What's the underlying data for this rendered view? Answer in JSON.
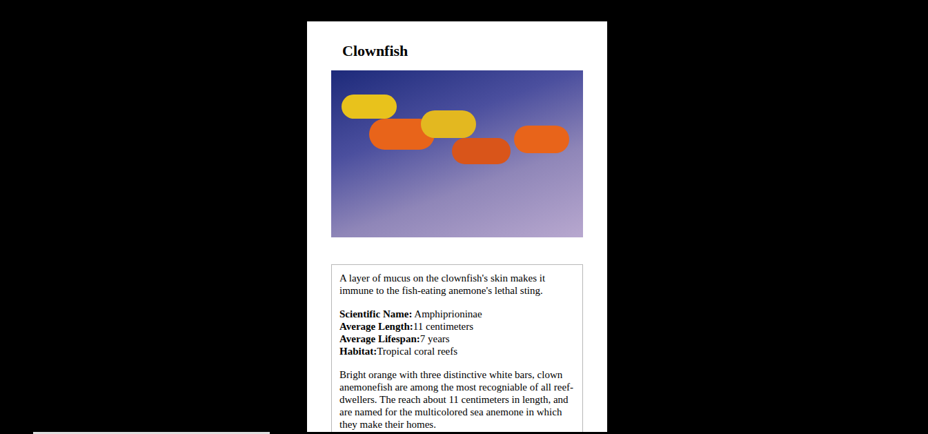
{
  "card": {
    "title": "Clownfish",
    "intro": "A layer of mucus on the clownfish's skin makes it immune to the fish-eating anemone's lethal sting.",
    "facts": [
      {
        "label": "Scientific Name:",
        "value": " Amphiprioninae"
      },
      {
        "label": "Average Length:",
        "value": "11 centimeters"
      },
      {
        "label": "Average Lifespan:",
        "value": "7 years"
      },
      {
        "label": "Habitat:",
        "value": "Tropical coral reefs"
      }
    ],
    "description": "Bright orange with three distinctive white bars, clown anemonefish are among the most recogniable of all reef-dwellers. The reach about 11 centimeters in length, and are named for the multicolored sea anemone in which they make their homes."
  }
}
